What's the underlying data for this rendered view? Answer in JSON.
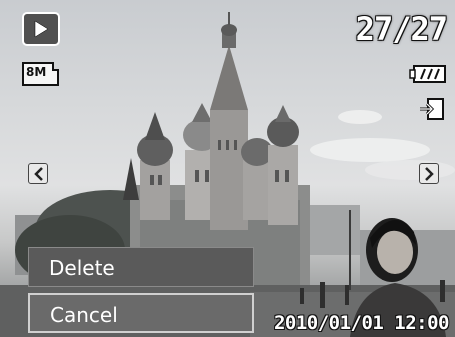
{
  "osd": {
    "counter": "27/27",
    "date": "2010/01/01",
    "time": "12:00",
    "play_icon": "play-mode-icon",
    "resolution_badge": "8M",
    "battery_icon": "battery-full-icon",
    "protect_icon": "protect-icon"
  },
  "menu": {
    "items": [
      {
        "label": "Delete"
      },
      {
        "label": "Cancel"
      }
    ],
    "selected_index": 1
  },
  "navigation": {
    "prev_icon": "chevron-left-icon",
    "next_icon": "chevron-right-icon"
  },
  "colors": {
    "menu_bg": "#5a5a5a",
    "selected_border": "#d0d0d0",
    "osd_text": "#ffffff"
  }
}
